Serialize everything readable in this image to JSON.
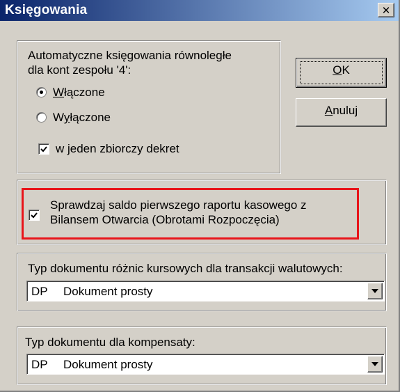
{
  "window": {
    "title": "Księgowania",
    "close_label": "✕"
  },
  "auto_posting": {
    "label_line1": "Automatyczne księgowania równoległe",
    "label_line2": "dla kont zespołu '4':",
    "radio_on": {
      "prefix": "",
      "accel": "W",
      "suffix": "łączone",
      "selected": true
    },
    "radio_off": {
      "prefix": "W",
      "accel": "y",
      "suffix": "łączone",
      "selected": false
    },
    "collective_checkbox": {
      "label": "w jeden zbiorczy dekret",
      "checked": true
    }
  },
  "buttons": {
    "ok": {
      "accel": "O",
      "rest": "K"
    },
    "cancel": {
      "accel": "A",
      "rest": "nuluj"
    }
  },
  "balance_check": {
    "checked": true,
    "line1": "Sprawdzaj saldo pierwszego raportu kasowego z",
    "line2": "Bilansem Otwarcia (Obrotami Rozpoczęcia)",
    "highlight_color": "#e8141a"
  },
  "exchange_diff": {
    "label": "Typ dokumentu różnic kursowych dla transakcji walutowych:",
    "selected_code": "DP",
    "selected_name": "Dokument prosty"
  },
  "compensation": {
    "label": "Typ dokumentu dla kompensaty:",
    "selected_code": "DP",
    "selected_name": "Dokument prosty"
  },
  "colors": {
    "dialog_bg": "#d4d0c8",
    "titlebar_start": "#0a246a",
    "titlebar_end": "#a6caf0"
  }
}
